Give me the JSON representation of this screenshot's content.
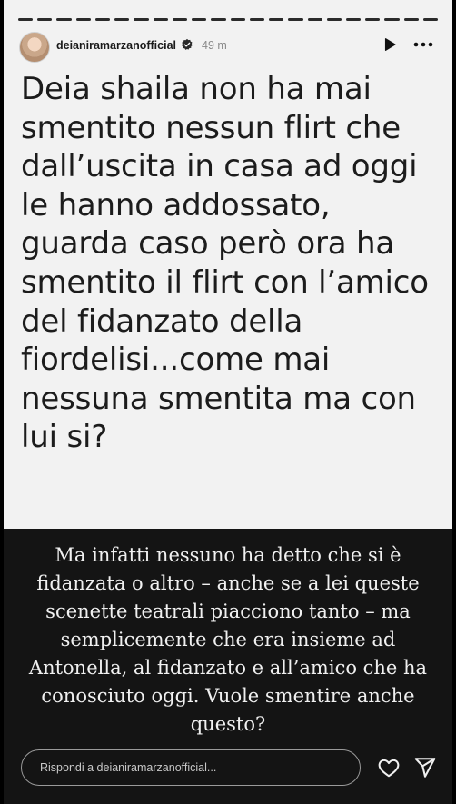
{
  "header": {
    "username": "deianiramarzanofficial",
    "time": "49 m",
    "icons": {
      "avatar": "profile-photo",
      "verified": "verified-badge-icon",
      "play": "play-icon",
      "more": "more-dots-icon"
    }
  },
  "progress": {
    "segments": 22
  },
  "post": {
    "lines": [
      "Deia shaila non ha mai",
      "smentito nessun flirt che",
      "dall’uscita in casa ad oggi",
      "le hanno addossato,",
      "guarda caso però ora ha",
      "smentito il flirt con l’amico",
      "del fidanzato della",
      "fiordelisi...come mai",
      "nessuna smentita ma con",
      "lui si?"
    ]
  },
  "caption": {
    "lines": [
      "Ma infatti nessuno ha detto che si è",
      "fidanzata o altro – anche se a lei queste",
      "scenette teatrali piacciono tanto – ma",
      "semplicemente che era insieme ad",
      "Antonella, al fidanzato e all’amico che ha",
      "conosciuto oggi. Vuole smentire anche",
      "questo?"
    ]
  },
  "footer": {
    "reply_placeholder": "Rispondi a deianiramarzanofficial...",
    "icons": {
      "like": "heart-icon",
      "send": "send-icon"
    }
  },
  "colors": {
    "story_background": "#f2f2f2",
    "caption_background": "#141414",
    "text_dark": "#1c1c1c",
    "text_light": "#f0f0f0",
    "muted": "#8a8a8a"
  }
}
